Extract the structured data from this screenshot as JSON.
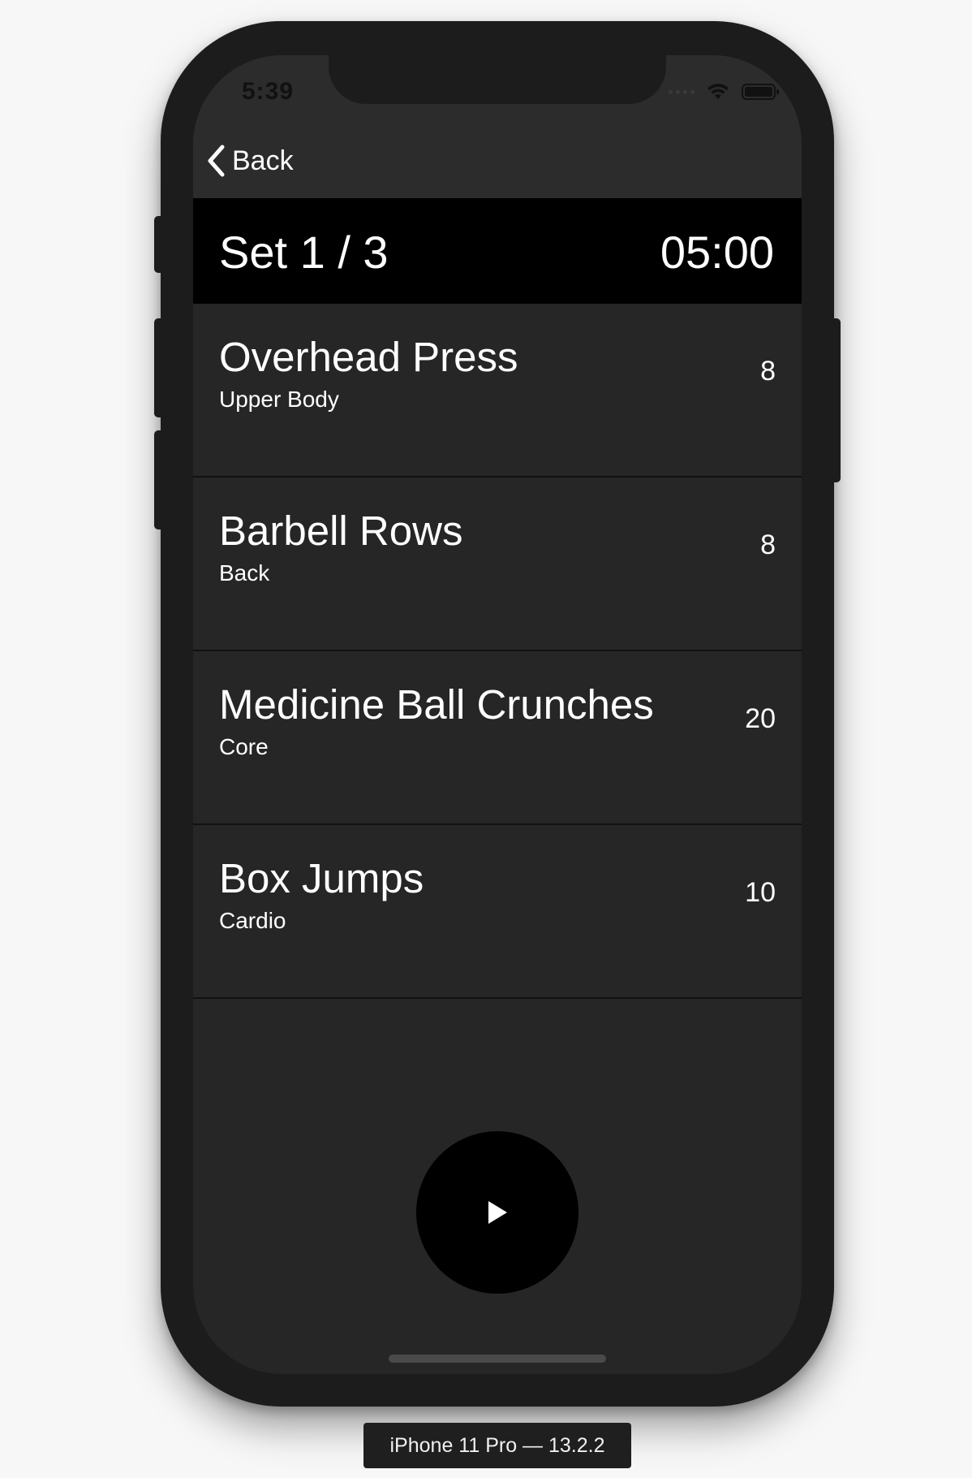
{
  "status_bar": {
    "time": "5:39"
  },
  "nav": {
    "back_label": "Back"
  },
  "set_header": {
    "title": "Set 1 / 3",
    "timer": "05:00"
  },
  "exercises": [
    {
      "name": "Overhead Press",
      "category": "Upper Body",
      "reps": "8"
    },
    {
      "name": "Barbell Rows",
      "category": "Back",
      "reps": "8"
    },
    {
      "name": "Medicine Ball Crunches",
      "category": "Core",
      "reps": "20"
    },
    {
      "name": "Box Jumps",
      "category": "Cardio",
      "reps": "10"
    }
  ],
  "controls": {
    "play_icon": "play-icon"
  },
  "simulator": {
    "device_label": "iPhone 11 Pro — 13.2.2"
  },
  "colors": {
    "screen_bg": "#262626",
    "header_bg": "#000000",
    "text": "#ffffff"
  }
}
